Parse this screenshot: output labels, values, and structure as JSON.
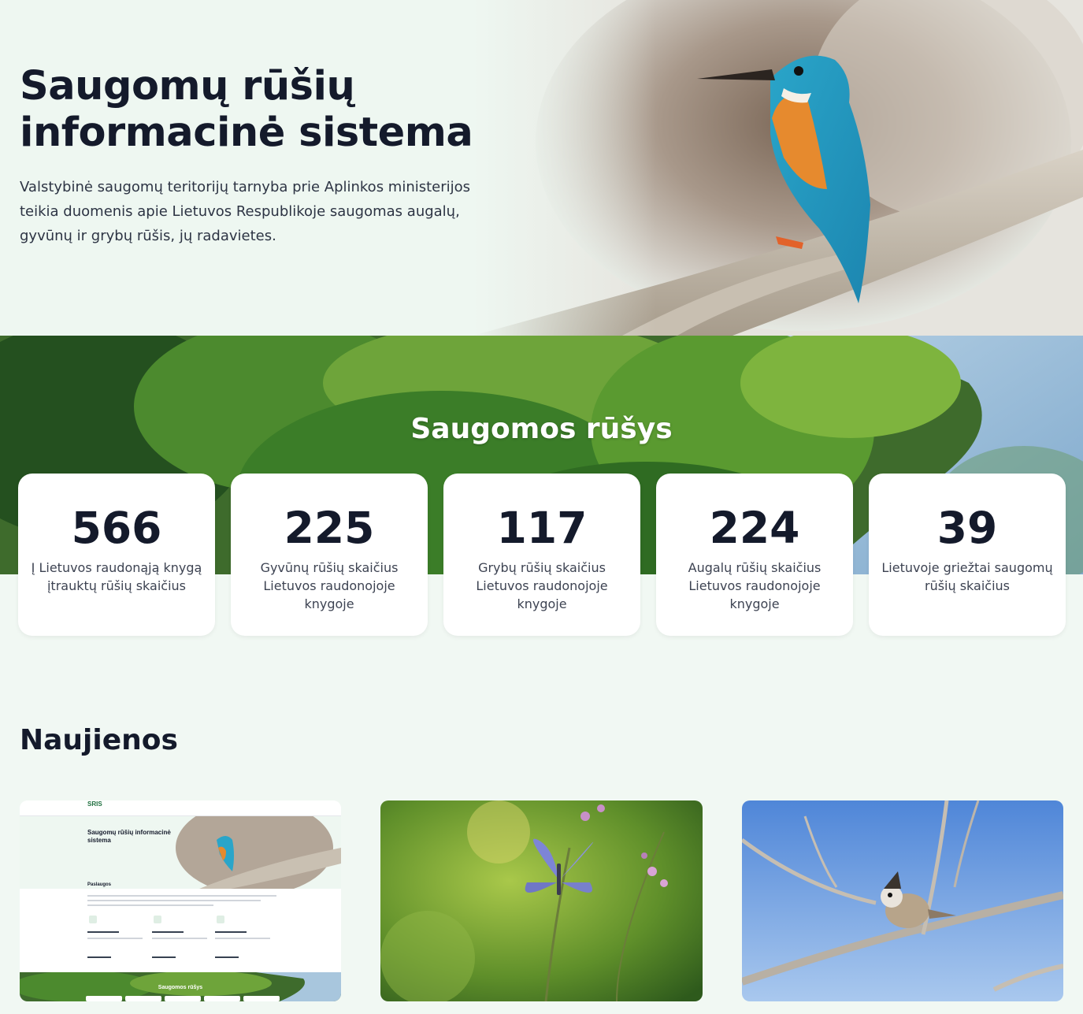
{
  "hero": {
    "title": "Saugomų rūšių informacinė sistema",
    "description": "Valstybinė saugomų teritorijų tarnyba prie Aplinkos ministerijos teikia duomenis apie Lietuvos Respublikoje saugomas augalų, gyvūnų ir grybų rūšis, jų radavietes."
  },
  "stats": {
    "title": "Saugomos rūšys",
    "cards": [
      {
        "value": "566",
        "label": "Į Lietuvos raudonąją knygą įtrauktų rūšių skaičius"
      },
      {
        "value": "225",
        "label": "Gyvūnų rūšių skaičius Lietuvos raudonojoje knygoje"
      },
      {
        "value": "117",
        "label": "Grybų rūšių skaičius Lietuvos raudonojoje knygoje"
      },
      {
        "value": "224",
        "label": "Augalų rūšių skaičius Lietuvos raudonojoje knygoje"
      },
      {
        "value": "39",
        "label": "Lietuvoje griežtai saugomų rūšių skaičius"
      }
    ]
  },
  "news": {
    "title": "Naujienos",
    "thumb": {
      "logo": "SRIS",
      "hero_title": "Saugomų rūšių informacinė sistema",
      "section": "Paslaugos",
      "stats_title": "Saugomos rūšys"
    }
  }
}
